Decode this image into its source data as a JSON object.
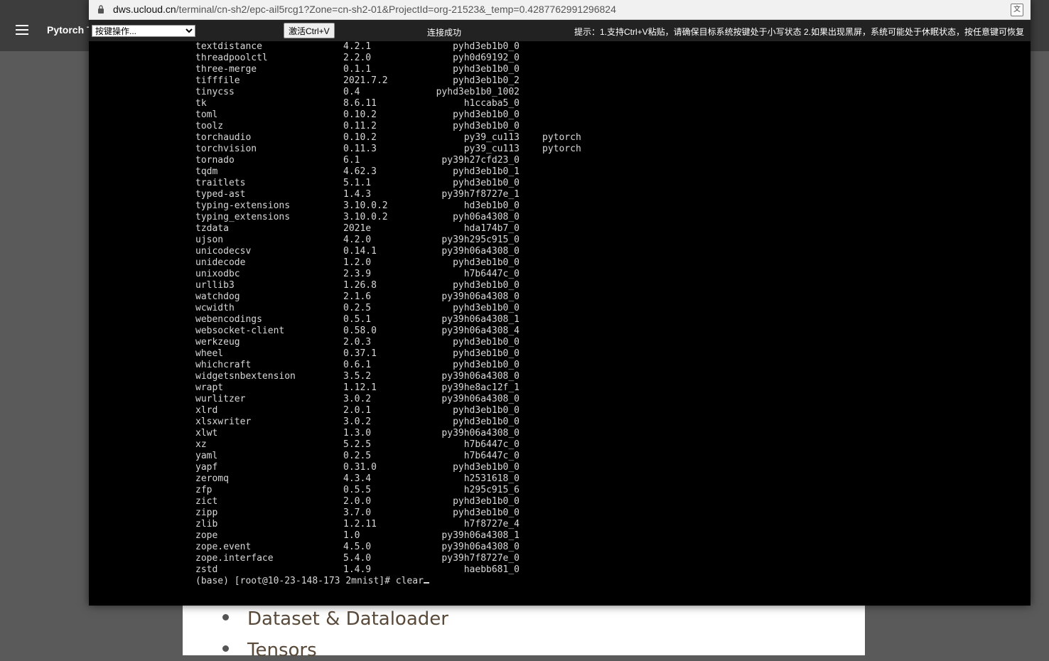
{
  "background_page": {
    "title": "Pytorch T",
    "list_items": [
      "Dataset & Dataloader",
      "Tensors"
    ]
  },
  "popup": {
    "url_host": "dws.ucloud.cn",
    "url_path": "/terminal/cn-sh2/epc-ail5rcg1?Zone=cn-sh2-01&ProjectId=org-21523&_temp=0.4287762991296824",
    "select_value": "按键操作...",
    "activate_button": "激活Ctrl+V",
    "connection_status": "连接成功",
    "hint": "提示：1.支持Ctrl+V粘贴，请确保目标系统按键处于小写状态  2.如果出现黑屏，系统可能处于休眠状态，按任意键可恢复",
    "translate_icon": "translate-icon"
  },
  "terminal": {
    "rows": [
      {
        "name": "textdistance",
        "version": "4.2.1",
        "build": "pyhd3eb1b0_0",
        "channel": ""
      },
      {
        "name": "threadpoolctl",
        "version": "2.2.0",
        "build": "pyh0d69192_0",
        "channel": ""
      },
      {
        "name": "three-merge",
        "version": "0.1.1",
        "build": "pyhd3eb1b0_0",
        "channel": ""
      },
      {
        "name": "tifffile",
        "version": "2021.7.2",
        "build": "pyhd3eb1b0_2",
        "channel": ""
      },
      {
        "name": "tinycss",
        "version": "0.4",
        "build": "pyhd3eb1b0_1002",
        "channel": ""
      },
      {
        "name": "tk",
        "version": "8.6.11",
        "build": "h1ccaba5_0",
        "channel": ""
      },
      {
        "name": "toml",
        "version": "0.10.2",
        "build": "pyhd3eb1b0_0",
        "channel": ""
      },
      {
        "name": "toolz",
        "version": "0.11.2",
        "build": "pyhd3eb1b0_0",
        "channel": ""
      },
      {
        "name": "torchaudio",
        "version": "0.10.2",
        "build": "py39_cu113",
        "channel": "pytorch"
      },
      {
        "name": "torchvision",
        "version": "0.11.3",
        "build": "py39_cu113",
        "channel": "pytorch"
      },
      {
        "name": "tornado",
        "version": "6.1",
        "build": "py39h27cfd23_0",
        "channel": ""
      },
      {
        "name": "tqdm",
        "version": "4.62.3",
        "build": "pyhd3eb1b0_1",
        "channel": ""
      },
      {
        "name": "traitlets",
        "version": "5.1.1",
        "build": "pyhd3eb1b0_0",
        "channel": ""
      },
      {
        "name": "typed-ast",
        "version": "1.4.3",
        "build": "py39h7f8727e_1",
        "channel": ""
      },
      {
        "name": "typing-extensions",
        "version": "3.10.0.2",
        "build": "hd3eb1b0_0",
        "channel": ""
      },
      {
        "name": "typing_extensions",
        "version": "3.10.0.2",
        "build": "pyh06a4308_0",
        "channel": ""
      },
      {
        "name": "tzdata",
        "version": "2021e",
        "build": "hda174b7_0",
        "channel": ""
      },
      {
        "name": "ujson",
        "version": "4.2.0",
        "build": "py39h295c915_0",
        "channel": ""
      },
      {
        "name": "unicodecsv",
        "version": "0.14.1",
        "build": "py39h06a4308_0",
        "channel": ""
      },
      {
        "name": "unidecode",
        "version": "1.2.0",
        "build": "pyhd3eb1b0_0",
        "channel": ""
      },
      {
        "name": "unixodbc",
        "version": "2.3.9",
        "build": "h7b6447c_0",
        "channel": ""
      },
      {
        "name": "urllib3",
        "version": "1.26.8",
        "build": "pyhd3eb1b0_0",
        "channel": ""
      },
      {
        "name": "watchdog",
        "version": "2.1.6",
        "build": "py39h06a4308_0",
        "channel": ""
      },
      {
        "name": "wcwidth",
        "version": "0.2.5",
        "build": "pyhd3eb1b0_0",
        "channel": ""
      },
      {
        "name": "webencodings",
        "version": "0.5.1",
        "build": "py39h06a4308_1",
        "channel": ""
      },
      {
        "name": "websocket-client",
        "version": "0.58.0",
        "build": "py39h06a4308_4",
        "channel": ""
      },
      {
        "name": "werkzeug",
        "version": "2.0.3",
        "build": "pyhd3eb1b0_0",
        "channel": ""
      },
      {
        "name": "wheel",
        "version": "0.37.1",
        "build": "pyhd3eb1b0_0",
        "channel": ""
      },
      {
        "name": "whichcraft",
        "version": "0.6.1",
        "build": "pyhd3eb1b0_0",
        "channel": ""
      },
      {
        "name": "widgetsnbextension",
        "version": "3.5.2",
        "build": "py39h06a4308_0",
        "channel": ""
      },
      {
        "name": "wrapt",
        "version": "1.12.1",
        "build": "py39he8ac12f_1",
        "channel": ""
      },
      {
        "name": "wurlitzer",
        "version": "3.0.2",
        "build": "py39h06a4308_0",
        "channel": ""
      },
      {
        "name": "xlrd",
        "version": "2.0.1",
        "build": "pyhd3eb1b0_0",
        "channel": ""
      },
      {
        "name": "xlsxwriter",
        "version": "3.0.2",
        "build": "pyhd3eb1b0_0",
        "channel": ""
      },
      {
        "name": "xlwt",
        "version": "1.3.0",
        "build": "py39h06a4308_0",
        "channel": ""
      },
      {
        "name": "xz",
        "version": "5.2.5",
        "build": "h7b6447c_0",
        "channel": ""
      },
      {
        "name": "yaml",
        "version": "0.2.5",
        "build": "h7b6447c_0",
        "channel": ""
      },
      {
        "name": "yapf",
        "version": "0.31.0",
        "build": "pyhd3eb1b0_0",
        "channel": ""
      },
      {
        "name": "zeromq",
        "version": "4.3.4",
        "build": "h2531618_0",
        "channel": ""
      },
      {
        "name": "zfp",
        "version": "0.5.5",
        "build": "h295c915_6",
        "channel": ""
      },
      {
        "name": "zict",
        "version": "2.0.0",
        "build": "pyhd3eb1b0_0",
        "channel": ""
      },
      {
        "name": "zipp",
        "version": "3.7.0",
        "build": "pyhd3eb1b0_0",
        "channel": ""
      },
      {
        "name": "zlib",
        "version": "1.2.11",
        "build": "h7f8727e_4",
        "channel": ""
      },
      {
        "name": "zope",
        "version": "1.0",
        "build": "py39h06a4308_1",
        "channel": ""
      },
      {
        "name": "zope.event",
        "version": "4.5.0",
        "build": "py39h06a4308_0",
        "channel": ""
      },
      {
        "name": "zope.interface",
        "version": "5.4.0",
        "build": "py39h7f8727e_0",
        "channel": ""
      },
      {
        "name": "zstd",
        "version": "1.4.9",
        "build": "haebb681_0",
        "channel": ""
      }
    ],
    "prompt": "(base) [root@10-23-148-173 2mnist]# clear"
  }
}
